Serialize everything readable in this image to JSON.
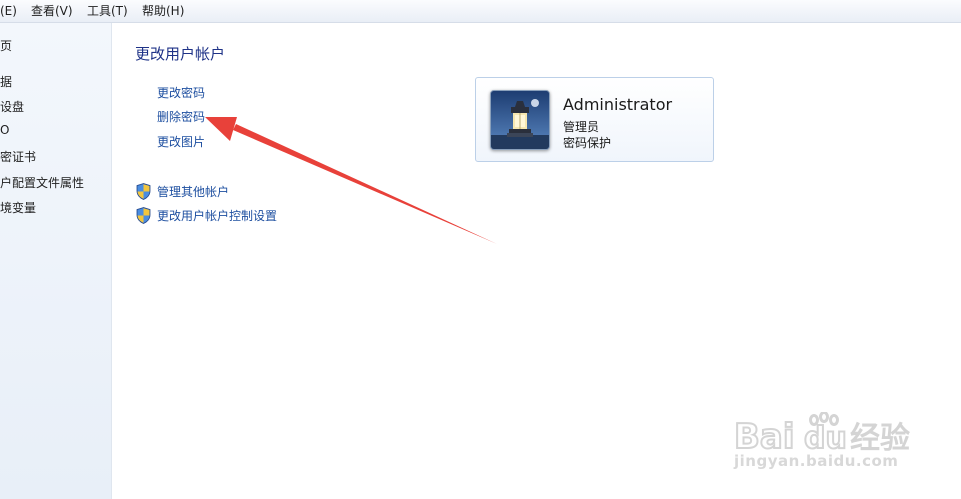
{
  "menubar": {
    "items": [
      "(E)",
      "查看(V)",
      "工具(T)",
      "帮助(H)"
    ]
  },
  "leftpane": {
    "items": [
      "页",
      "据",
      "设盘",
      "O",
      "密证书",
      "户配置文件属性",
      "境变量"
    ]
  },
  "main": {
    "title": "更改用户帐户",
    "links": [
      "更改密码",
      "删除密码",
      "更改图片"
    ],
    "admin_links": [
      "管理其他帐户",
      "更改用户帐户控制设置"
    ]
  },
  "account": {
    "name": "Administrator",
    "role": "管理员",
    "protection": "密码保护"
  },
  "watermark": {
    "brand": "Baidu经验",
    "url": "jingyan.baidu.com"
  },
  "colors": {
    "link": "#1e4fa0",
    "title": "#1e3287",
    "arrow": "#e8413a"
  }
}
